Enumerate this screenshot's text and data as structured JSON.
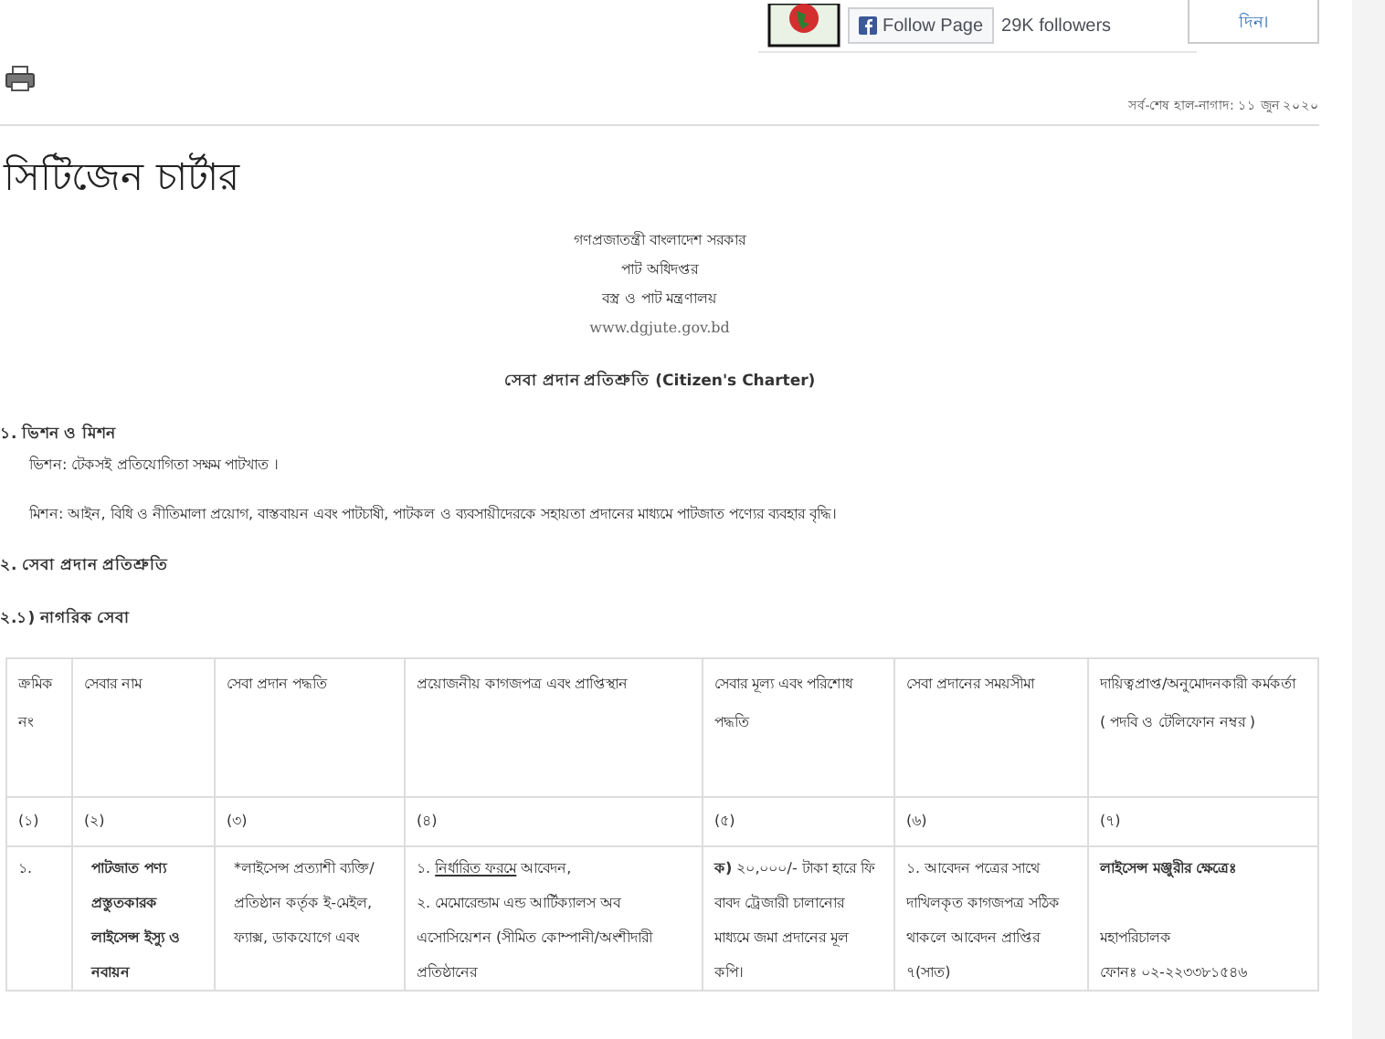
{
  "social_widget": {
    "follow_button": "Follow Page",
    "followers": "29K followers",
    "side_note": "দিন।"
  },
  "last_updated": "সর্ব-শেষ হাল-নাগাদ: ১১ জুন ২০২০",
  "title": "সিটিজেন চার্টার",
  "organization": [
    "গণপ্রজাতন্ত্রী বাংলাদেশ সরকার",
    "পাট অধিদপ্তর",
    "বস্ত্র ও পাট মন্ত্রণালয়"
  ],
  "website": "www.dgjute.gov.bd",
  "charter_heading": "সেবা প্রদান প্রতিশ্রুতি (Citizen's Charter)",
  "sections": [
    {
      "heading": "১. ভিশন ও মিশন",
      "paragraphs": [
        "ভিশন: টেকসই প্রতিযোগিতা সক্ষম পাটখাত ।",
        "মিশন: আইন, বিধি ও নীতিমালা প্রয়োগ, বাস্তবায়ন এবং পাটচাষী, পাটকল ও ব্যবসায়ীদেরকে সহায়তা প্রদানের মাধ্যমে পাটজাত পণ্যের ব্যবহার বৃদ্ধি।"
      ]
    },
    {
      "heading": "২. সেবা প্রদান প্রতিশ্রুতি"
    },
    {
      "heading": "২.১) নাগরিক সেবা"
    }
  ],
  "table": {
    "columns": [
      {
        "label": "ক্রমিক নং"
      },
      {
        "label": "সেবার নাম"
      },
      {
        "label": "সেবা প্রদান পদ্ধতি"
      },
      {
        "label": "প্রয়োজনীয় কাগজপত্র এবং প্রাপ্তিস্থান"
      },
      {
        "label": "সেবার মূল্য এবং পরিশোধ পদ্ধতি"
      },
      {
        "label": "সেবা প্রদানের সময়সীমা"
      },
      {
        "label": "দায়িত্বপ্রাপ্ত/অনুমোদনকারী কর্মকর্তা",
        "note": "( পদবি ও টেলিফোন নম্বর )"
      }
    ],
    "numbers": [
      "(১)",
      "(২)",
      "(৩)",
      "(৪)",
      "(৫)",
      "(৬)",
      "(৭)"
    ],
    "rows": [
      [
        {
          "kind": "plain",
          "paragraphs": [
            "১."
          ]
        },
        {
          "kind": "bold",
          "paragraphs": [
            "পাটজাত পণ্য প্রস্তুতকারক লাইসেন্স ইস্যু ও নবায়ন"
          ]
        },
        {
          "kind": "plain",
          "paragraphs": [
            "*লাইসেন্স প্রত্যাশী ব্যক্তি/ প্রতিষ্ঠান কর্তৃক ই-মেইল, ফ্যাক্স, ডাকযোগে এবং"
          ]
        },
        {
          "kind": "items",
          "paragraphs": [
            {
              "before": "১. ",
              "link": "নির্ধারিত ফরমে",
              "after": " আবেদন,"
            },
            {
              "before": "২. মেমোরেন্ডাম এন্ড আর্টিক্যালস অব এসোসিয়েশন (সীমিত কোম্পানী/অংশীদারী প্রতিষ্ঠানের"
            }
          ]
        },
        {
          "kind": "plain",
          "paragraphs": [
            "**ক)** ২০,০০০/- টাকা হারে ফি বাবদ ট্রেজারী চালানোর মাধ্যমে জমা প্রদানের মূল কপি।"
          ]
        },
        {
          "kind": "plain",
          "paragraphs": [
            "১. আবেদন পত্রের সাথে দাখিলকৃত কাগজপত্র সঠিক থাকলে আবেদন প্রাপ্তির ৭(সাত)"
          ]
        },
        {
          "kind": "officer",
          "paragraphs": [
            "লাইসেন্স মঞ্জুরীর ক্ষেত্রেঃ",
            "মহাপরিচালক",
            "ফোনঃ ০২-২২৩৩৮১৫৪৬"
          ]
        }
      ]
    ]
  }
}
